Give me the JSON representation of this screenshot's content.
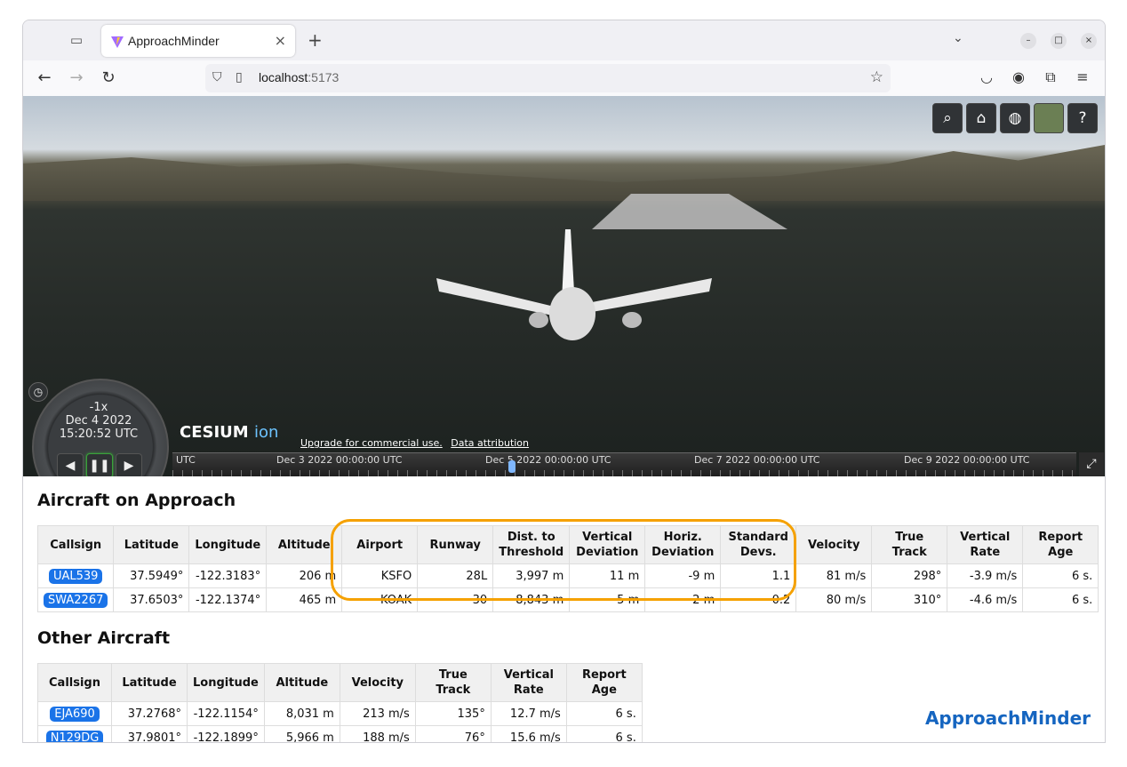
{
  "browser": {
    "tab_title": "ApproachMinder",
    "url_host": "localhost",
    "url_port": ":5173"
  },
  "viewer": {
    "toolbar": [
      "search-icon",
      "home-icon",
      "globe-icon",
      "imagery-icon",
      "help-icon"
    ],
    "animation": {
      "speed": "-1x",
      "date": "Dec 4 2022",
      "time": "15:20:52 UTC"
    },
    "logo_main": "CESIUM",
    "logo_ion": "ion",
    "credit_upgrade": "Upgrade for commercial use.",
    "credit_attribution": "Data attribution",
    "timeline": {
      "utc": "UTC",
      "labels": [
        "Dec 3 2022 00:00:00 UTC",
        "Dec 5 2022 00:00:00 UTC",
        "Dec 7 2022 00:00:00 UTC",
        "Dec 9 2022 00:00:00 UTC"
      ]
    }
  },
  "approach": {
    "title": "Aircraft on Approach",
    "headers": [
      "Callsign",
      "Latitude",
      "Longitude",
      "Altitude",
      "Airport",
      "Runway",
      "Dist. to\nThreshold",
      "Vertical\nDeviation",
      "Horiz.\nDeviation",
      "Standard\nDevs.",
      "Velocity",
      "True\nTrack",
      "Vertical\nRate",
      "Report\nAge"
    ],
    "rows": [
      [
        "UAL539",
        "37.5949°",
        "-122.3183°",
        "206 m",
        "KSFO",
        "28L",
        "3,997 m",
        "11 m",
        "-9 m",
        "1.1",
        "81 m/s",
        "298°",
        "-3.9 m/s",
        "6 s."
      ],
      [
        "SWA2267",
        "37.6503°",
        "-122.1374°",
        "465 m",
        "KOAK",
        "30",
        "8,843 m",
        "-5 m",
        "2 m",
        "0.2",
        "80 m/s",
        "310°",
        "-4.6 m/s",
        "6 s."
      ]
    ]
  },
  "other": {
    "title": "Other Aircraft",
    "headers": [
      "Callsign",
      "Latitude",
      "Longitude",
      "Altitude",
      "Velocity",
      "True\nTrack",
      "Vertical\nRate",
      "Report\nAge"
    ],
    "rows": [
      [
        "EJA690",
        "37.2768°",
        "-122.1154°",
        "8,031 m",
        "213 m/s",
        "135°",
        "12.7 m/s",
        "6 s."
      ],
      [
        "N129DG",
        "37.9801°",
        "-122.1899°",
        "5,966 m",
        "188 m/s",
        "76°",
        "15.6 m/s",
        "6 s."
      ]
    ]
  },
  "brand": "ApproachMinder"
}
